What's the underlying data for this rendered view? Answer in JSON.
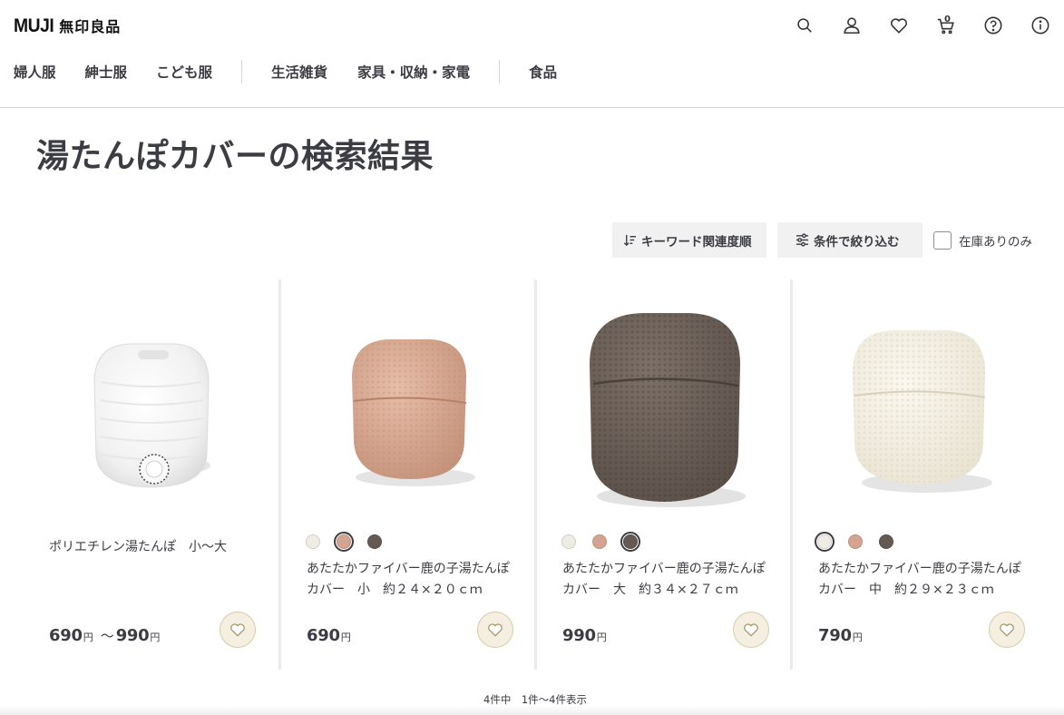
{
  "header": {
    "logo_text": "MUJI",
    "logo_jp": "無印良品",
    "cart_count": "0",
    "icons": [
      "search-icon",
      "user-icon",
      "heart-icon",
      "cart-icon",
      "help-icon",
      "info-icon"
    ]
  },
  "nav": {
    "group1": [
      "婦人服",
      "紳士服",
      "こども服"
    ],
    "group2": [
      "生活雑貨",
      "家具・収納・家電"
    ],
    "group3": [
      "食品"
    ]
  },
  "search": {
    "keyword": "湯たんぽカバー",
    "suffix": "の検索結果"
  },
  "toolbar": {
    "sort_label": "キーワード関連度順",
    "filter_label": "条件で絞り込む",
    "stock_label": "在庫ありのみ",
    "stock_checked": false
  },
  "products": [
    {
      "name_line1": "ポリエチレン湯たんぽ　小〜大",
      "name_line2": "",
      "price_from": "690",
      "price_to": "990",
      "yen": "円",
      "tilde": "～",
      "swatches": []
    },
    {
      "name_line1": "あたたかファイバー鹿の子湯たんぽ",
      "name_line2": "カバー　小　約２４×２０ｃｍ",
      "price": "690",
      "yen": "円",
      "swatches": [
        {
          "color": "#efece4",
          "selected": false
        },
        {
          "color": "#d4a490",
          "selected": true
        },
        {
          "color": "#645a53",
          "selected": false
        }
      ]
    },
    {
      "name_line1": "あたたかファイバー鹿の子湯たんぽ",
      "name_line2": "カバー　大　約３４×２７ｃｍ",
      "price": "990",
      "yen": "円",
      "swatches": [
        {
          "color": "#efece4",
          "selected": false
        },
        {
          "color": "#d4a490",
          "selected": false
        },
        {
          "color": "#645a53",
          "selected": true
        }
      ]
    },
    {
      "name_line1": "あたたかファイバー鹿の子湯たんぽ",
      "name_line2": "カバー　中　約２９×２３ｃｍ",
      "price": "790",
      "yen": "円",
      "swatches": [
        {
          "color": "#efece4",
          "selected": true
        },
        {
          "color": "#d4a490",
          "selected": false
        },
        {
          "color": "#645a53",
          "selected": false
        }
      ]
    }
  ],
  "result_count": "4件中　1件〜4件表示"
}
